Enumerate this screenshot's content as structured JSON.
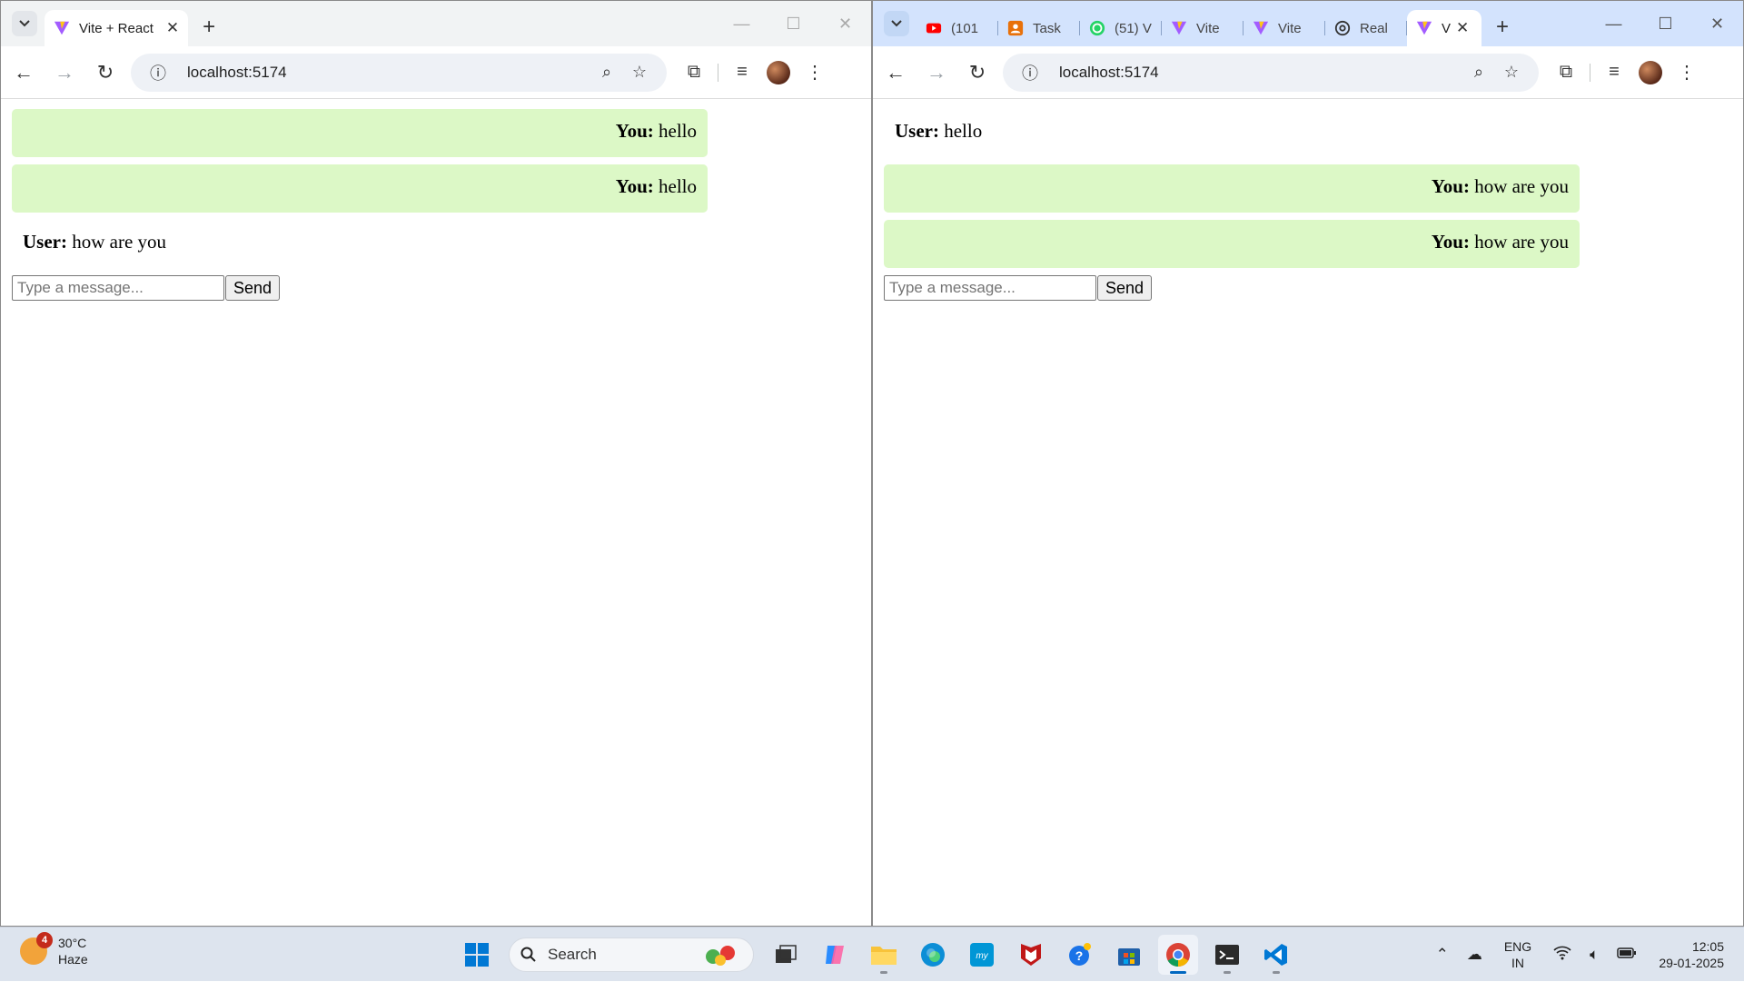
{
  "left_window": {
    "tabs": [
      {
        "title": "Vite + React",
        "close": "✕",
        "active": true
      }
    ],
    "new_tab": "+",
    "controls": {
      "minimize": "—",
      "maximize": "☐",
      "close": "✕"
    },
    "url": "localhost:5174",
    "chat": {
      "messages": [
        {
          "sender": "You:",
          "text": " hello",
          "kind": "you"
        },
        {
          "sender": "You:",
          "text": " hello",
          "kind": "you"
        },
        {
          "sender": "User:",
          "text": " how are you",
          "kind": "user"
        }
      ],
      "input_placeholder": "Type a message...",
      "send_label": "Send"
    }
  },
  "right_window": {
    "tabs": [
      {
        "title": "(101",
        "icon": "youtube-icon"
      },
      {
        "title": "Task",
        "icon": "task-icon"
      },
      {
        "title": "(51) V",
        "icon": "whatsapp-icon"
      },
      {
        "title": "Vite",
        "icon": "vite-icon"
      },
      {
        "title": "Vite",
        "icon": "vite-icon"
      },
      {
        "title": "Real",
        "icon": "openai-icon"
      },
      {
        "title": "V",
        "icon": "vite-icon",
        "active": true,
        "close": "✕"
      }
    ],
    "new_tab": "+",
    "controls": {
      "minimize": "—",
      "maximize": "☐",
      "close": "✕"
    },
    "url": "localhost:5174",
    "chat": {
      "messages": [
        {
          "sender": "User:",
          "text": " hello",
          "kind": "user"
        },
        {
          "sender": "You:",
          "text": " how are you",
          "kind": "you"
        },
        {
          "sender": "You:",
          "text": " how are you",
          "kind": "you"
        }
      ],
      "input_placeholder": "Type a message...",
      "send_label": "Send"
    }
  },
  "taskbar": {
    "weather": {
      "temp": "30°C",
      "condition": "Haze",
      "badge": "4"
    },
    "search_label": "Search",
    "language": {
      "line1": "ENG",
      "line2": "IN"
    },
    "clock": {
      "time": "12:05",
      "date": "29-01-2025"
    }
  },
  "colors": {
    "you_bubble": "#dcf8c6",
    "left_tabstrip": "#f1f3f4",
    "right_tabstrip": "#d3e3fd",
    "taskbar": "#dde4ee"
  }
}
